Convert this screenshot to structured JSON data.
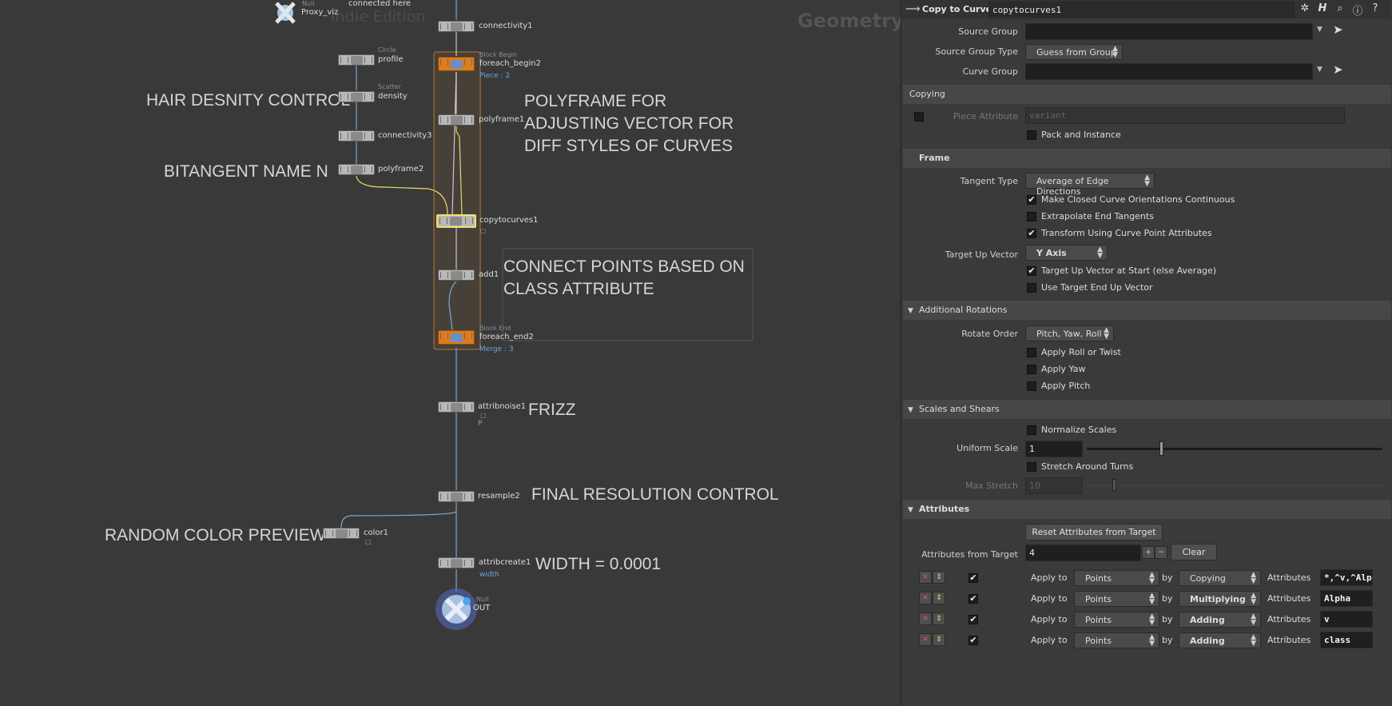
{
  "network": {
    "watermark_edition": "Indie Edition",
    "watermark_context": "Geometry",
    "sticky_notes": {
      "hair_density": "HAIR DESNITY CONTROL",
      "bitangent": "BITANGENT NAME N",
      "polyframe_note": "POLYFRAME FOR\nADJUSTING VECTOR FOR\nDIFF STYLES OF CURVES",
      "connect_points": "CONNECT POINTS BASED ON\nCLASS ATTRIBUTE",
      "frizz": "FRIZZ",
      "final_res": "FINAL RESOLUTION CONTROL",
      "random_color": "RANDOM COLOR PREVIEW",
      "width_note": "WIDTH = 0.0001"
    },
    "nodes": {
      "proxy_viz": {
        "type": "Null",
        "label": "Proxy_viz",
        "note": "connected here"
      },
      "connectivity1": {
        "label": "connectivity1"
      },
      "profile": {
        "type": "Circle",
        "label": "profile"
      },
      "density": {
        "type": "Scatter",
        "label": "density"
      },
      "connectivity3": {
        "label": "connectivity3"
      },
      "polyframe2": {
        "label": "polyframe2"
      },
      "foreach_begin2": {
        "type": "Block Begin",
        "label": "foreach_begin2",
        "note": "Piece : 2"
      },
      "polyframe1": {
        "label": "polyframe1"
      },
      "copytocurves1": {
        "label": "copytocurves1"
      },
      "add1": {
        "label": "add1"
      },
      "foreach_end2": {
        "type": "Block End",
        "label": "foreach_end2",
        "note": "Merge : 3"
      },
      "attribnoise1": {
        "label": "attribnoise1",
        "note": "P"
      },
      "resample2": {
        "label": "resample2"
      },
      "color1": {
        "label": "color1"
      },
      "attribcreate1": {
        "label": "attribcreate1",
        "note": "width"
      },
      "out": {
        "type": "Null",
        "label": "OUT"
      }
    }
  },
  "params": {
    "node_type": "Copy to Curves",
    "node_name": "copytocurves1",
    "source_group_label": "Source Group",
    "source_group_value": "",
    "source_group_type_label": "Source Group Type",
    "source_group_type_value": "Guess from Group",
    "curve_group_label": "Curve Group",
    "curve_group_value": "",
    "copying_section": "Copying",
    "piece_attribute_label": "Piece Attribute",
    "piece_attribute_value": "variant",
    "pack_and_instance": "Pack and Instance",
    "frame_section": "Frame",
    "tangent_type_label": "Tangent Type",
    "tangent_type_value": "Average of Edge Directions",
    "make_closed": "Make Closed Curve Orientations Continuous",
    "extrapolate": "Extrapolate End Tangents",
    "transform_using": "Transform Using Curve Point Attributes",
    "target_up_label": "Target Up Vector",
    "target_up_value": "Y Axis",
    "target_up_start": "Target Up Vector at Start (else Average)",
    "use_target_end": "Use Target End Up Vector",
    "additional_rotations_section": "Additional Rotations",
    "rotate_order_label": "Rotate Order",
    "rotate_order_value": "Pitch, Yaw, Roll",
    "apply_roll": "Apply Roll or Twist",
    "apply_yaw": "Apply Yaw",
    "apply_pitch": "Apply Pitch",
    "scales_section": "Scales and Shears",
    "normalize_scales": "Normalize Scales",
    "uniform_scale_label": "Uniform Scale",
    "uniform_scale_value": "1",
    "uniform_scale_fraction": 0.25,
    "stretch_around": "Stretch Around Turns",
    "max_stretch_label": "Max Stretch",
    "max_stretch_value": "10",
    "attributes_section": "Attributes",
    "reset_button": "Reset Attributes from Target",
    "attrs_from_target_label": "Attributes from Target",
    "attrs_from_target_value": "4",
    "clear_button": "Clear",
    "plus": "+",
    "minus": "−",
    "apply_to_label": "Apply to",
    "by_label": "by",
    "attributes_label": "Attributes",
    "rows": [
      {
        "apply_to": "Points",
        "by": "Copying",
        "attributes": "*,^v,^Alpha"
      },
      {
        "apply_to": "Points",
        "by": "Multiplying",
        "attributes": "Alpha"
      },
      {
        "apply_to": "Points",
        "by": "Adding",
        "attributes": "v"
      },
      {
        "apply_to": "Points",
        "by": "Adding",
        "attributes": "class"
      }
    ]
  },
  "icons": [
    "gear-icon",
    "help-h-icon",
    "search-icon",
    "info-icon",
    "question-icon",
    "arrow-select-icon",
    "remove-x-icon",
    "reorder-icon"
  ],
  "colors": {
    "block_node": "#e07a1a",
    "selected_outline": "#f3e06a",
    "wire": "#7fa6cc",
    "note_blue": "#6aa4e0"
  }
}
